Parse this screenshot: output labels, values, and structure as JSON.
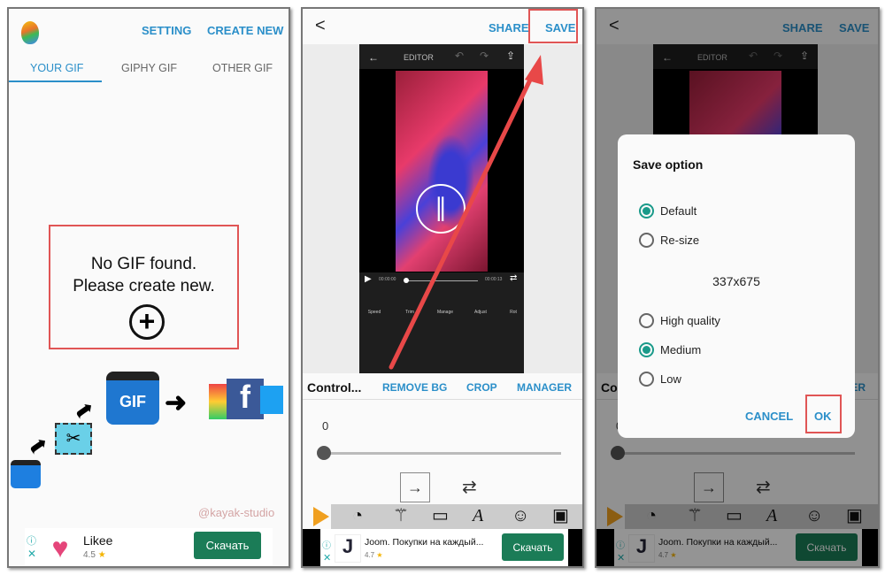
{
  "colors": {
    "accent": "#2b8fc9",
    "highlight": "#e05555",
    "radio": "#1a9a8a",
    "download_button": "#1b7c57",
    "watermark": "#d4a5a5"
  },
  "panel1": {
    "header": {
      "setting": "SETTING",
      "create_new": "CREATE NEW"
    },
    "tabs": [
      {
        "label": "YOUR GIF",
        "active": true
      },
      {
        "label": "GIPHY GIF"
      },
      {
        "label": "OTHER GIF"
      }
    ],
    "empty": {
      "line1": "No GIF found.",
      "line2": "Please create new.",
      "icon": "plus-circle-icon"
    },
    "illustration": {
      "gif_label": "GIF"
    },
    "watermark": "@kayak-studio",
    "ad": {
      "title": "Likee",
      "rating": "4.5",
      "star": "★",
      "button": "Скачать"
    }
  },
  "panel2": {
    "header": {
      "back": "<",
      "share": "SHARE",
      "save": "SAVE"
    },
    "editor": {
      "title": "EDITOR",
      "time_start": "00:00:00",
      "time_end": "00:00:13",
      "tools": [
        "Speed",
        "Trim",
        "Manage",
        "Adjust",
        "Rot"
      ]
    },
    "tabs": {
      "current": "Control...",
      "remove_bg": "REMOVE BG",
      "crop": "CROP",
      "manager": "MANAGER"
    },
    "slider": {
      "value_label": "0",
      "value": 0
    },
    "ad": {
      "title": "Joom. Покупки на каждый...",
      "rating": "4.7",
      "star": "★",
      "button": "Скачать"
    }
  },
  "dialog": {
    "title": "Save option",
    "size_options": [
      {
        "label": "Default",
        "selected": true
      },
      {
        "label": "Re-size",
        "selected": false
      }
    ],
    "dimensions": "337x675",
    "quality_options": [
      {
        "label": "High quality",
        "selected": false
      },
      {
        "label": "Medium",
        "selected": true
      },
      {
        "label": "Low",
        "selected": false
      }
    ],
    "cancel": "CANCEL",
    "ok": "OK"
  }
}
